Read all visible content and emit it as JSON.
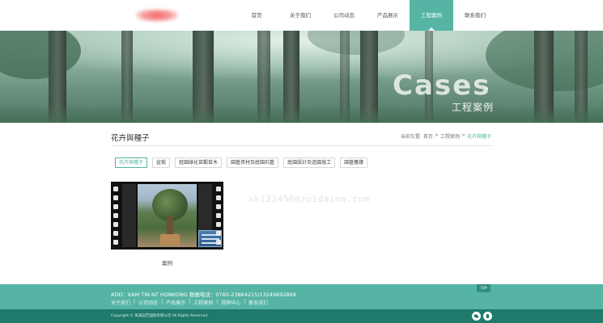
{
  "header": {
    "nav": [
      {
        "label": "首页"
      },
      {
        "label": "关于我们"
      },
      {
        "label": "公司动态"
      },
      {
        "label": "产品展示"
      },
      {
        "label": "工程案例",
        "active": true
      },
      {
        "label": "联系我们"
      }
    ]
  },
  "banner": {
    "title": "Cases",
    "subtitle": "工程案例"
  },
  "page": {
    "title": "花卉與種子",
    "breadcrumb": {
      "prefix": "当前位置:",
      "home": "首页",
      "sep1": ">",
      "section": "工程案例",
      "sep2": ">",
      "current": "花卉與種子"
    }
  },
  "categories": [
    {
      "label": "花卉與種子",
      "active": true
    },
    {
      "label": "盆栽"
    },
    {
      "label": "庭園綠化苗觀苗木"
    },
    {
      "label": "園藝資材及庭園石藝"
    },
    {
      "label": "庭園設計及造園施工"
    },
    {
      "label": "園藝養護"
    }
  ],
  "cases": [
    {
      "caption": "案例"
    }
  ],
  "watermark": "xk123456@zuidaima.com",
  "footer": {
    "address": "ADD：KAM TIN NT HONKONG 数据电话：0760-23864215/13249692869",
    "links": [
      "关于我们",
      "公司动态",
      "产品展示",
      "工程案例",
      "视频中心",
      "联系我们"
    ],
    "top_label": "TOP",
    "copyright": "Copyright © 某某园艺国际有限公司 All Rights Reserved"
  },
  "colors": {
    "accent": "#56b4a5",
    "footer_dark": "#1f7a6b"
  },
  "icons": [
    "wechat-icon",
    "qq-icon"
  ]
}
